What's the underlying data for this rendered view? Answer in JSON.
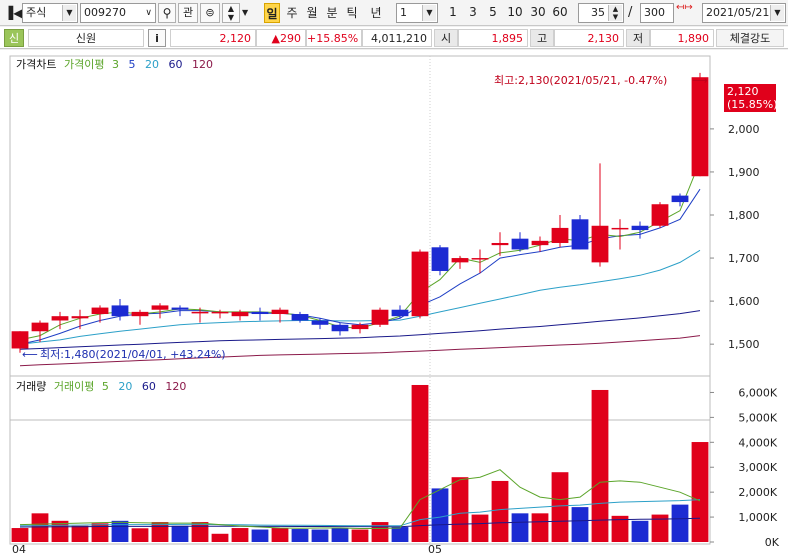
{
  "toolbar": {
    "market": "주식",
    "code": "009270",
    "btn_kwan": "관",
    "periods": [
      "일",
      "주",
      "월",
      "분",
      "틱",
      "년"
    ],
    "interval_value": "1",
    "intervals": [
      "1",
      "3",
      "5",
      "10",
      "30",
      "60"
    ],
    "count": "35",
    "separator": "/",
    "total": "300",
    "date": "2021/05/21"
  },
  "quote": {
    "badge": "신",
    "name": "신원",
    "info_btn": "i",
    "price": "2,120",
    "change": "▲290",
    "change_pct": "+15.85%",
    "volume": "4,011,210",
    "open_label": "시",
    "open": "1,895",
    "high_label": "고",
    "high": "2,130",
    "low_label": "저",
    "low": "1,890",
    "strength_btn": "체결강도"
  },
  "colors": {
    "up": "#e0001b",
    "down": "#1c2bd2",
    "ma3": "#5ba52a",
    "ma5": "#1f3fc5",
    "ma20": "#2ca0c8",
    "ma60": "#1a1a8a",
    "ma120": "#8b1a4a"
  },
  "price_panel": {
    "legend_title": "가격차트",
    "legend_ma_prefix": "가격이평",
    "legend_periods": [
      "3",
      "5",
      "20",
      "60",
      "120"
    ],
    "high_note": "최고:2,130(2021/05/21, -0.47%)",
    "low_note": "최저:1,480(2021/04/01, +43.24%)",
    "current_price": "2,120",
    "current_pct": "(15.85%)",
    "y_ticks": [
      "1,500",
      "1,600",
      "1,700",
      "1,800",
      "1,900",
      "2,000"
    ]
  },
  "volume_panel": {
    "legend_title": "거래량",
    "legend_ma_prefix": "거래이평",
    "legend_periods": [
      "5",
      "20",
      "60",
      "120"
    ],
    "y_ticks": [
      "0K",
      "1,000K",
      "2,000K",
      "3,000K",
      "4,000K",
      "5,000K",
      "6,000K"
    ]
  },
  "x_labels": [
    "04",
    "05"
  ],
  "chart_data": {
    "type": "candlestick",
    "ylim": [
      1440,
      2160
    ],
    "vol_ylim": [
      0,
      6500
    ],
    "candles": [
      {
        "o": 1490,
        "h": 1530,
        "l": 1480,
        "c": 1530,
        "v": 560
      },
      {
        "o": 1530,
        "h": 1555,
        "l": 1505,
        "c": 1550,
        "v": 1150
      },
      {
        "o": 1555,
        "h": 1575,
        "l": 1535,
        "c": 1565,
        "v": 850
      },
      {
        "o": 1560,
        "h": 1580,
        "l": 1535,
        "c": 1565,
        "v": 650
      },
      {
        "o": 1570,
        "h": 1590,
        "l": 1550,
        "c": 1585,
        "v": 750
      },
      {
        "o": 1590,
        "h": 1605,
        "l": 1555,
        "c": 1565,
        "v": 850
      },
      {
        "o": 1565,
        "h": 1580,
        "l": 1545,
        "c": 1575,
        "v": 550
      },
      {
        "o": 1580,
        "h": 1595,
        "l": 1560,
        "c": 1590,
        "v": 800
      },
      {
        "o": 1585,
        "h": 1590,
        "l": 1565,
        "c": 1580,
        "v": 650
      },
      {
        "o": 1575,
        "h": 1585,
        "l": 1550,
        "c": 1575,
        "v": 800
      },
      {
        "o": 1575,
        "h": 1580,
        "l": 1560,
        "c": 1575,
        "v": 330
      },
      {
        "o": 1565,
        "h": 1580,
        "l": 1555,
        "c": 1575,
        "v": 560
      },
      {
        "o": 1575,
        "h": 1585,
        "l": 1555,
        "c": 1570,
        "v": 500
      },
      {
        "o": 1570,
        "h": 1585,
        "l": 1550,
        "c": 1580,
        "v": 560
      },
      {
        "o": 1570,
        "h": 1575,
        "l": 1550,
        "c": 1555,
        "v": 520
      },
      {
        "o": 1555,
        "h": 1560,
        "l": 1535,
        "c": 1545,
        "v": 500
      },
      {
        "o": 1545,
        "h": 1550,
        "l": 1520,
        "c": 1530,
        "v": 560
      },
      {
        "o": 1535,
        "h": 1550,
        "l": 1525,
        "c": 1545,
        "v": 500
      },
      {
        "o": 1545,
        "h": 1585,
        "l": 1540,
        "c": 1580,
        "v": 800
      },
      {
        "o": 1580,
        "h": 1590,
        "l": 1560,
        "c": 1565,
        "v": 600
      },
      {
        "o": 1565,
        "h": 1720,
        "l": 1560,
        "c": 1715,
        "v": 6300
      },
      {
        "o": 1725,
        "h": 1730,
        "l": 1660,
        "c": 1670,
        "v": 2150
      },
      {
        "o": 1690,
        "h": 1705,
        "l": 1675,
        "c": 1700,
        "v": 2600
      },
      {
        "o": 1700,
        "h": 1720,
        "l": 1665,
        "c": 1700,
        "v": 1100
      },
      {
        "o": 1730,
        "h": 1760,
        "l": 1705,
        "c": 1735,
        "v": 2450
      },
      {
        "o": 1745,
        "h": 1760,
        "l": 1715,
        "c": 1720,
        "v": 1150
      },
      {
        "o": 1730,
        "h": 1750,
        "l": 1715,
        "c": 1740,
        "v": 1150
      },
      {
        "o": 1735,
        "h": 1800,
        "l": 1725,
        "c": 1770,
        "v": 2800
      },
      {
        "o": 1790,
        "h": 1800,
        "l": 1720,
        "c": 1720,
        "v": 1400
      },
      {
        "o": 1690,
        "h": 1920,
        "l": 1680,
        "c": 1775,
        "v": 6100
      },
      {
        "o": 1770,
        "h": 1790,
        "l": 1720,
        "c": 1770,
        "v": 1050
      },
      {
        "o": 1775,
        "h": 1785,
        "l": 1745,
        "c": 1765,
        "v": 850
      },
      {
        "o": 1775,
        "h": 1830,
        "l": 1770,
        "c": 1825,
        "v": 1100
      },
      {
        "o": 1845,
        "h": 1850,
        "l": 1820,
        "c": 1830,
        "v": 1500
      },
      {
        "o": 1890,
        "h": 2130,
        "l": 1890,
        "c": 2120,
        "v": 4011
      }
    ],
    "ma3": [
      1510,
      1520,
      1545,
      1560,
      1570,
      1575,
      1570,
      1575,
      1582,
      1580,
      1575,
      1575,
      1575,
      1573,
      1567,
      1555,
      1540,
      1537,
      1550,
      1565,
      1620,
      1650,
      1700,
      1690,
      1712,
      1718,
      1730,
      1745,
      1740,
      1755,
      1750,
      1760,
      1785,
      1810,
      1925
    ],
    "ma5": [
      1500,
      1510,
      1525,
      1542,
      1555,
      1565,
      1570,
      1572,
      1578,
      1578,
      1575,
      1574,
      1572,
      1572,
      1568,
      1560,
      1550,
      1545,
      1550,
      1560,
      1590,
      1610,
      1640,
      1665,
      1700,
      1708,
      1715,
      1725,
      1730,
      1745,
      1752,
      1755,
      1770,
      1790,
      1860
    ],
    "ma20": [
      1500,
      1505,
      1510,
      1518,
      1524,
      1530,
      1535,
      1540,
      1545,
      1548,
      1550,
      1552,
      1553,
      1554,
      1555,
      1555,
      1554,
      1554,
      1555,
      1556,
      1565,
      1575,
      1585,
      1595,
      1605,
      1615,
      1625,
      1632,
      1638,
      1645,
      1652,
      1660,
      1672,
      1690,
      1718
    ],
    "ma60": [
      1488,
      1490,
      1492,
      1494,
      1496,
      1498,
      1500,
      1502,
      1504,
      1506,
      1508,
      1509,
      1510,
      1511,
      1512,
      1513,
      1514,
      1515,
      1517,
      1519,
      1522,
      1525,
      1528,
      1531,
      1535,
      1538,
      1541,
      1545,
      1549,
      1553,
      1557,
      1561,
      1566,
      1571,
      1578
    ],
    "ma120": [
      1450,
      1452,
      1454,
      1456,
      1458,
      1460,
      1462,
      1464,
      1466,
      1468,
      1470,
      1472,
      1474,
      1475,
      1476,
      1477,
      1478,
      1479,
      1480,
      1482,
      1484,
      1486,
      1488,
      1490,
      1492,
      1494,
      1496,
      1498,
      1500,
      1502,
      1505,
      1508,
      1511,
      1514,
      1520
    ],
    "vma5": [
      700,
      720,
      740,
      760,
      780,
      790,
      770,
      760,
      760,
      760,
      700,
      640,
      600,
      560,
      550,
      560,
      560,
      540,
      540,
      560,
      1700,
      2100,
      2500,
      2600,
      2900,
      2200,
      1800,
      1700,
      1800,
      2400,
      2450,
      2400,
      2200,
      2000,
      1650
    ],
    "vma20": [
      650,
      660,
      670,
      680,
      690,
      700,
      700,
      700,
      705,
      705,
      700,
      690,
      680,
      675,
      670,
      665,
      660,
      655,
      650,
      650,
      900,
      1000,
      1150,
      1200,
      1300,
      1350,
      1400,
      1450,
      1480,
      1550,
      1600,
      1620,
      1640,
      1660,
      1700
    ],
    "vma60": [
      600,
      605,
      610,
      615,
      620,
      625,
      625,
      625,
      628,
      630,
      630,
      628,
      626,
      624,
      622,
      620,
      618,
      616,
      614,
      613,
      660,
      690,
      720,
      740,
      770,
      790,
      810,
      830,
      850,
      880,
      900,
      910,
      920,
      930,
      950
    ]
  }
}
